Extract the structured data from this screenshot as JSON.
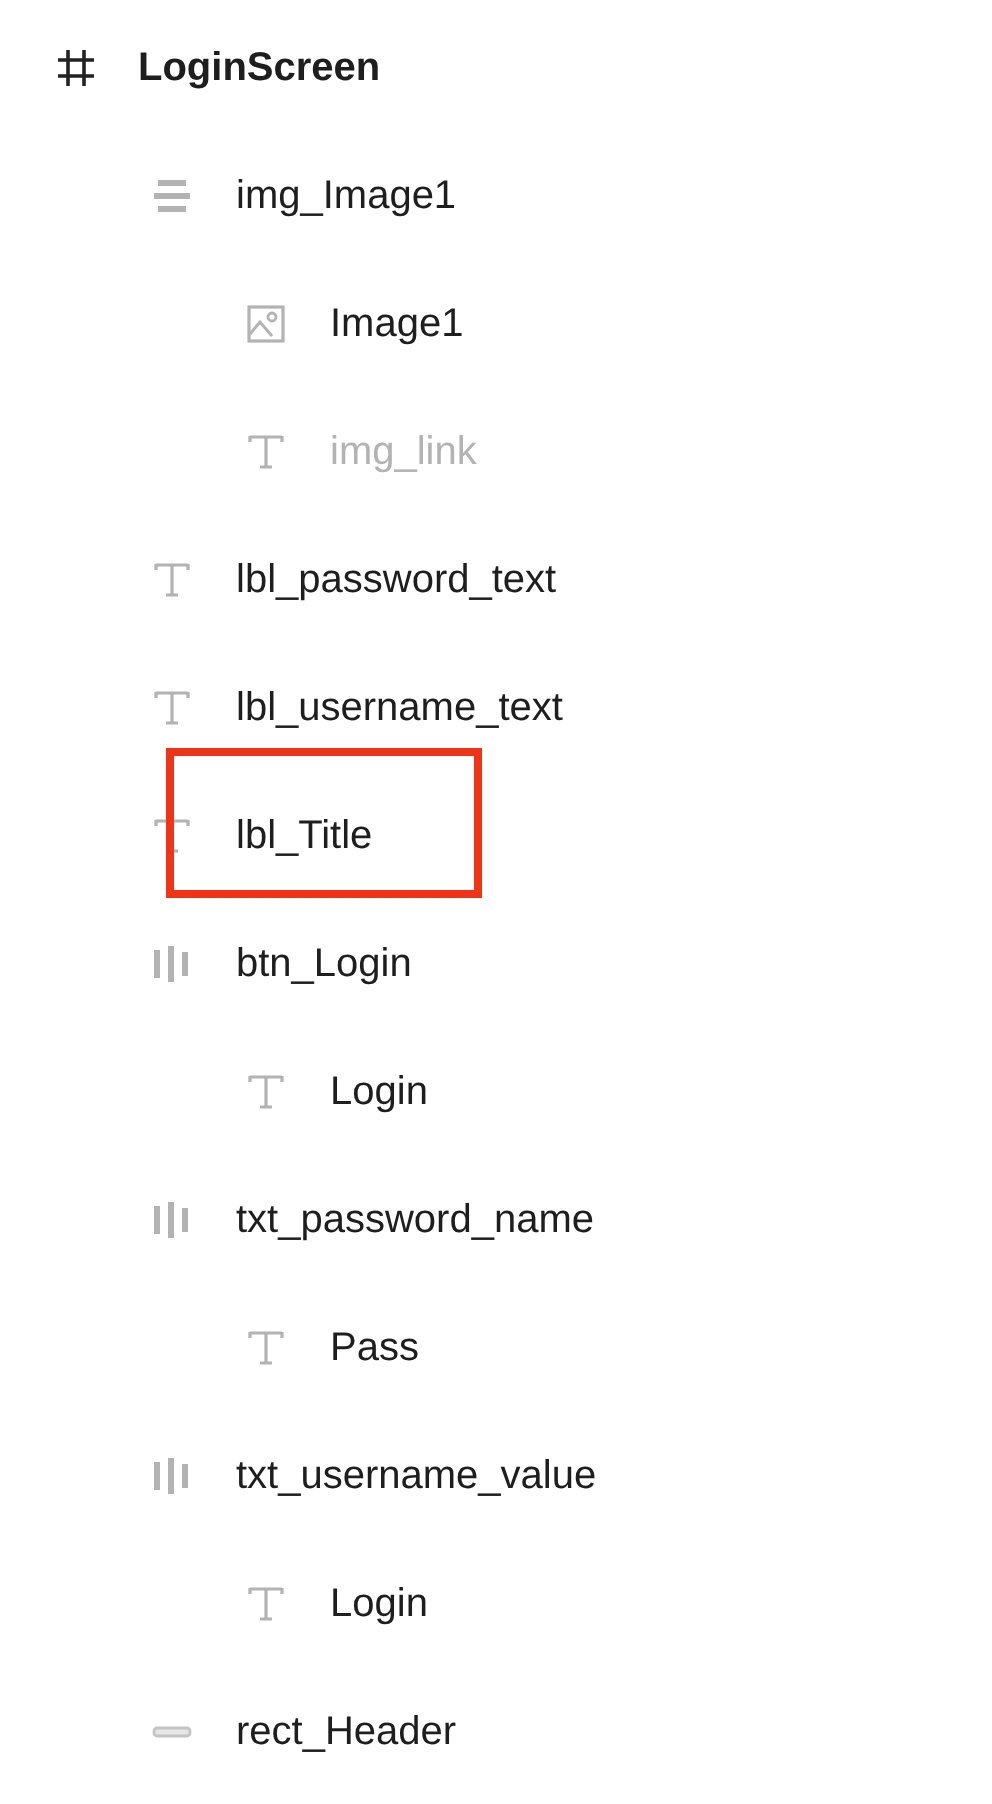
{
  "layers": {
    "name": "LoginScreen",
    "kind": "frame",
    "hidden": false,
    "highlighted": false,
    "children": [
      {
        "name": "img_Image1",
        "kind": "stack",
        "hidden": false,
        "highlighted": false,
        "children": [
          {
            "name": "Image1",
            "kind": "image",
            "hidden": false,
            "highlighted": false
          },
          {
            "name": "img_link",
            "kind": "text",
            "hidden": true,
            "highlighted": false
          }
        ]
      },
      {
        "name": "lbl_password_text",
        "kind": "text",
        "hidden": false,
        "highlighted": false
      },
      {
        "name": "lbl_username_text",
        "kind": "text",
        "hidden": false,
        "highlighted": false
      },
      {
        "name": "lbl_Title",
        "kind": "text",
        "hidden": false,
        "highlighted": true
      },
      {
        "name": "btn_Login",
        "kind": "row",
        "hidden": false,
        "highlighted": false,
        "children": [
          {
            "name": "Login",
            "kind": "text",
            "hidden": false,
            "highlighted": false
          }
        ]
      },
      {
        "name": "txt_password_name",
        "kind": "row",
        "hidden": false,
        "highlighted": false,
        "children": [
          {
            "name": "Pass",
            "kind": "text",
            "hidden": false,
            "highlighted": false
          }
        ]
      },
      {
        "name": "txt_username_value",
        "kind": "row",
        "hidden": false,
        "highlighted": false,
        "children": [
          {
            "name": "Login",
            "kind": "text",
            "hidden": false,
            "highlighted": false
          }
        ]
      },
      {
        "name": "rect_Header",
        "kind": "rect",
        "hidden": false,
        "highlighted": false
      }
    ]
  }
}
